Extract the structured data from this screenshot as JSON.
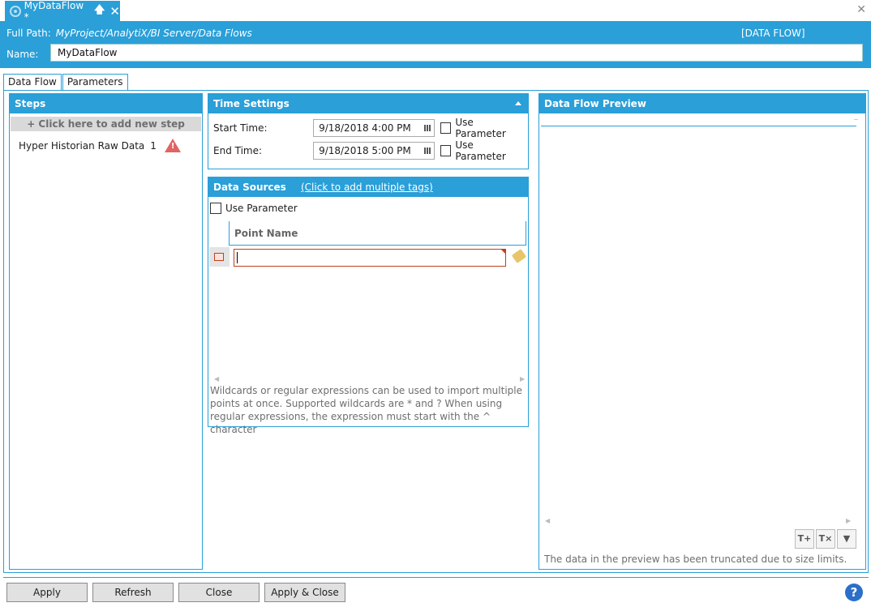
{
  "doc_tab": {
    "title": "MyDataFlow *",
    "pin_glyph": "🡅",
    "close_glyph": "✕"
  },
  "window_close_glyph": "✕",
  "header": {
    "full_path_label": "Full Path:",
    "full_path_value": "MyProject/AnalytiX/BI Server/Data Flows",
    "kind": "[DATA FLOW]",
    "name_label": "Name:",
    "name_value": "MyDataFlow"
  },
  "view_tabs": [
    {
      "label": "Data Flow",
      "active": true
    },
    {
      "label": "Parameters",
      "active": false
    }
  ],
  "steps": {
    "title": "Steps",
    "add_label": "+ Click here to add new step",
    "items": [
      {
        "label": "Hyper Historian Raw Data",
        "count": "1",
        "status": "warning"
      }
    ]
  },
  "time_settings": {
    "title": "Time Settings",
    "start_label": "Start Time:",
    "start_value": "9/18/2018 4:00 PM",
    "end_label": "End Time:",
    "end_value": "9/18/2018 5:00 PM",
    "use_param_label": "Use Parameter"
  },
  "data_sources": {
    "title": "Data Sources",
    "link": "(Click to add multiple tags)",
    "use_param_label": "Use Parameter",
    "column_header": "Point Name",
    "hint": "Wildcards or regular expressions can be used to import multiple points at once. Supported wildcards are * and ? When using regular expressions, the expression must start with the ^ character"
  },
  "preview": {
    "title": "Data Flow Preview",
    "truncated_note": "The data in the preview has been truncated due to size limits.",
    "tool_glyphs": [
      "T+",
      "T×",
      "▼"
    ]
  },
  "buttons": {
    "apply": "Apply",
    "refresh": "Refresh",
    "close": "Close",
    "apply_close": "Apply & Close",
    "help_glyph": "?"
  },
  "colors": {
    "accent": "#2a9fd8",
    "warning": "#e06464",
    "error_border": "#c04020"
  }
}
